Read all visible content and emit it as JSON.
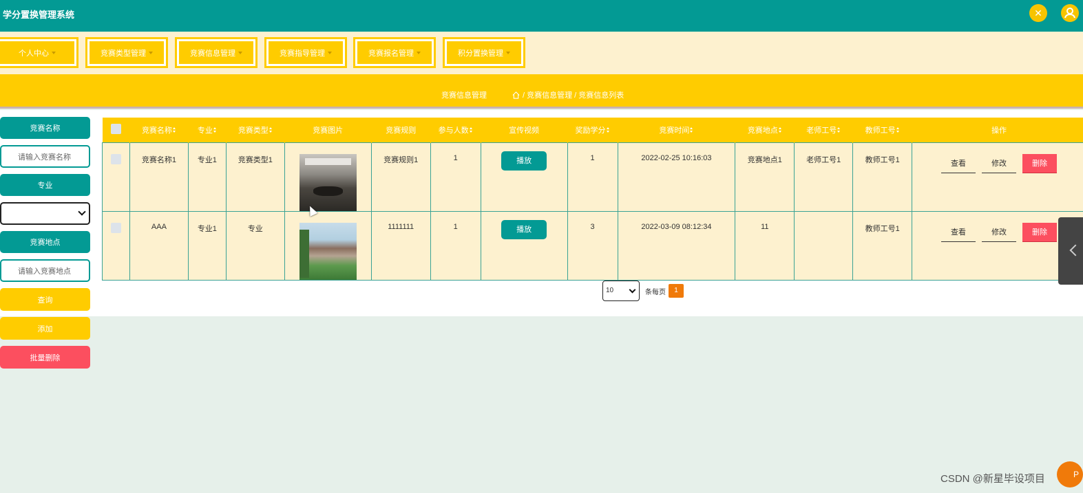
{
  "app": {
    "title": "学分置换管理系统"
  },
  "header": {
    "fullscreen_icon": "expand-arrows-icon",
    "user_icon": "user-icon",
    "accent": "#039a94",
    "menu_accent": "#ffcc00"
  },
  "menu": [
    {
      "label": "个人中心"
    },
    {
      "label": "竞赛类型管理"
    },
    {
      "label": "竞赛信息管理"
    },
    {
      "label": "竞赛指导管理"
    },
    {
      "label": "竞赛报名管理"
    },
    {
      "label": "积分置换管理"
    }
  ],
  "breadcrumb": {
    "section": "竞赛信息管理",
    "path": "/ 竞赛信息管理 / 竞赛信息列表"
  },
  "search": {
    "name_label": "竞赛名称",
    "name_placeholder": "请输入竞赛名称",
    "major_label": "专业",
    "major_value": "",
    "location_label": "竞赛地点",
    "location_placeholder": "请输入竞赛地点",
    "query_button": "查询",
    "add_button": "添加",
    "batch_delete_button": "批量删除"
  },
  "table": {
    "columns": [
      "竞赛名称",
      "专业",
      "竞赛类型",
      "竞赛图片",
      "竞赛规则",
      "参与人数",
      "宣传视频",
      "奖励学分",
      "竞赛时间",
      "竞赛地点",
      "老师工号",
      "教师工号",
      "操作"
    ],
    "rows": [
      {
        "name": "竞赛名称1",
        "major": "专业1",
        "type": "竞赛类型1",
        "rule": "竞赛规则1",
        "count": "1",
        "play": "播放",
        "credits": "1",
        "time": "2022-02-25 10:16:03",
        "location": "竞赛地点1",
        "teacher_id": "老师工号1",
        "instructor_id": "教师工号1",
        "view": "查看",
        "edit": "修改",
        "delete": "删除"
      },
      {
        "name": "AAA",
        "major": "专业1",
        "type": "专业",
        "rule": "1111111",
        "count": "1",
        "play": "播放",
        "credits": "3",
        "time": "2022-03-09 08:12:34",
        "location": "11",
        "teacher_id": "",
        "instructor_id": "教师工号1",
        "view": "查看",
        "edit": "修改",
        "delete": "删除"
      }
    ]
  },
  "pagination": {
    "page_size": "10",
    "per_page_text": "条每页",
    "current_page": "1"
  },
  "watermark": "CSDN @新星毕设项目",
  "fab_label": "P"
}
